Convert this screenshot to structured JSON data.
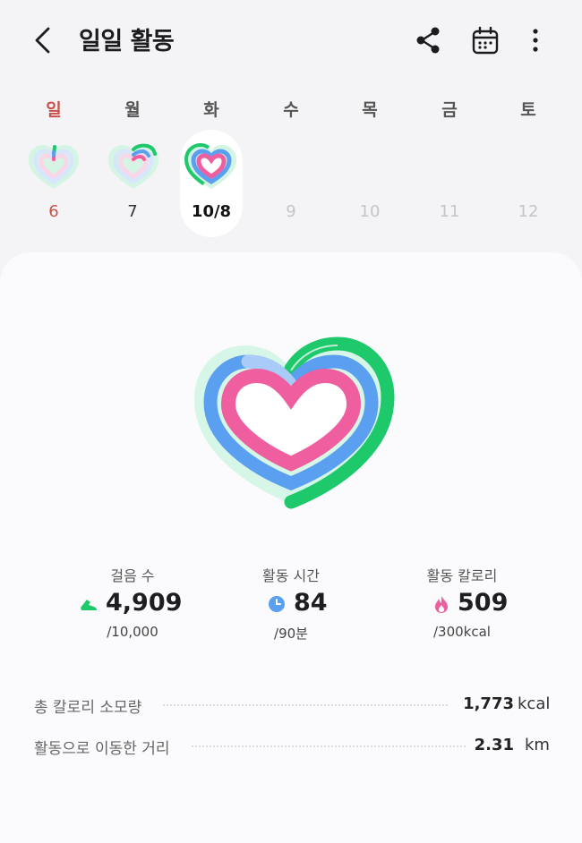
{
  "header": {
    "title": "일일 활동",
    "back_icon": "chevron-left-icon",
    "share_icon": "share-icon",
    "calendar_icon": "calendar-icon",
    "more_icon": "more-vertical-icon"
  },
  "week": {
    "days": [
      {
        "dow": "일",
        "date": "6"
      },
      {
        "dow": "월",
        "date": "7"
      },
      {
        "dow": "화",
        "date": "10/8"
      },
      {
        "dow": "수",
        "date": "9"
      },
      {
        "dow": "목",
        "date": "10"
      },
      {
        "dow": "금",
        "date": "11"
      },
      {
        "dow": "토",
        "date": "12"
      }
    ],
    "selected_index": 2
  },
  "metrics": {
    "steps": {
      "label": "걸음 수",
      "value": "4,909",
      "goal": "/10,000",
      "icon": "shoe-icon",
      "progress": 0.49
    },
    "active_time": {
      "label": "활동 시간",
      "value": "84",
      "goal": "/90분",
      "icon": "clock-icon",
      "progress": 0.93
    },
    "calories": {
      "label": "활동 칼로리",
      "value": "509",
      "goal": "/300kcal",
      "icon": "flame-icon",
      "progress": 1.0
    }
  },
  "summary": {
    "total_calories": {
      "label": "총 칼로리 소모량",
      "value": "1,773",
      "unit": "kcal"
    },
    "distance": {
      "label": "활동으로 이동한 거리",
      "value": "2.31",
      "unit": "km"
    }
  },
  "colors": {
    "steps": "#1dc96b",
    "active_time": "#5b9ff0",
    "calories": "#ef5f9f",
    "sunday": "#c8524b"
  }
}
